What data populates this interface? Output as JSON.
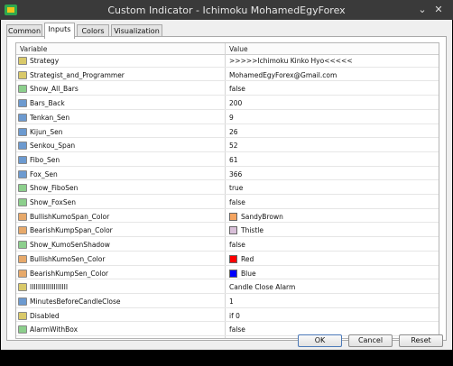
{
  "window": {
    "title": "Custom Indicator - Ichimoku MohamedEgyForex"
  },
  "tabs": [
    {
      "label": "Common"
    },
    {
      "label": "Inputs"
    },
    {
      "label": "Colors"
    },
    {
      "label": "Visualization"
    }
  ],
  "table": {
    "columns": [
      "Variable",
      "Value"
    ],
    "rows": [
      {
        "type": "string",
        "variable": "Strategy",
        "value": ">>>>>Ichimoku Kinko Hyo<<<<<"
      },
      {
        "type": "string",
        "variable": "Strategist_and_Programmer",
        "value": "MohamedEgyForex@Gmail.com"
      },
      {
        "type": "bool",
        "variable": "Show_All_Bars",
        "value": "false"
      },
      {
        "type": "int",
        "variable": "Bars_Back",
        "value": "200"
      },
      {
        "type": "int",
        "variable": "Tenkan_Sen",
        "value": "9"
      },
      {
        "type": "int",
        "variable": "Kijun_Sen",
        "value": "26"
      },
      {
        "type": "int",
        "variable": "Senkou_Span",
        "value": "52"
      },
      {
        "type": "int",
        "variable": "Fibo_Sen",
        "value": "61"
      },
      {
        "type": "int",
        "variable": "Fox_Sen",
        "value": "366"
      },
      {
        "type": "bool",
        "variable": "Show_FiboSen",
        "value": "true"
      },
      {
        "type": "bool",
        "variable": "Show_FoxSen",
        "value": "false"
      },
      {
        "type": "color",
        "variable": "BullishKumoSpan_Color",
        "value": "SandyBrown",
        "swatch": "#F4A460"
      },
      {
        "type": "color",
        "variable": "BearishKumpSpan_Color",
        "value": "Thistle",
        "swatch": "#D8BFD8"
      },
      {
        "type": "bool",
        "variable": "Show_KumoSenShadow",
        "value": "false"
      },
      {
        "type": "color",
        "variable": "BullishKumoSen_Color",
        "value": "Red",
        "swatch": "#FF0000"
      },
      {
        "type": "color",
        "variable": "BearishKumpSen_Color",
        "value": "Blue",
        "swatch": "#0000FF"
      },
      {
        "type": "string",
        "variable": "IIIIIIIIIIIIIIIIIII",
        "value": "Candle Close Alarm"
      },
      {
        "type": "int",
        "variable": "MinutesBeforeCandleClose",
        "value": "1"
      },
      {
        "type": "string",
        "variable": "Disabled",
        "value": "if 0"
      },
      {
        "type": "bool",
        "variable": "AlarmWithBox",
        "value": "false"
      }
    ]
  },
  "buttons": {
    "ok": "OK",
    "cancel": "Cancel",
    "reset": "Reset"
  }
}
